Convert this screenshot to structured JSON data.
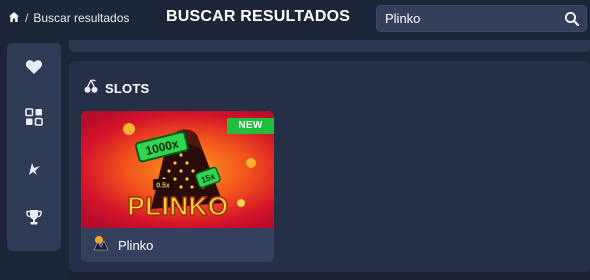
{
  "breadcrumb": {
    "home_icon": "home-icon",
    "separator": "/",
    "current": "Buscar resultados"
  },
  "page": {
    "title": "BUSCAR RESULTADOS"
  },
  "search": {
    "value": "Plinko",
    "icon": "search-icon"
  },
  "sidebar": {
    "items": [
      {
        "icon": "heart-icon"
      },
      {
        "icon": "grid-icon"
      },
      {
        "icon": "rocket-icon"
      },
      {
        "icon": "trophy-icon"
      }
    ]
  },
  "section": {
    "icon": "cherries-icon",
    "title": "SLOTS"
  },
  "games": [
    {
      "name": "Plinko",
      "badge": "NEW",
      "provider_icon": "provider-logo-icon",
      "art": {
        "logo": "PLINKO",
        "mult_a": "1000x",
        "mult_b": "15x",
        "mult_c": "0.5x"
      }
    }
  ],
  "colors": {
    "background": "#1c2638",
    "panel": "#253047",
    "sidebar": "#2f3b55",
    "badge": "#1fbf3c",
    "search": "#34405a"
  }
}
